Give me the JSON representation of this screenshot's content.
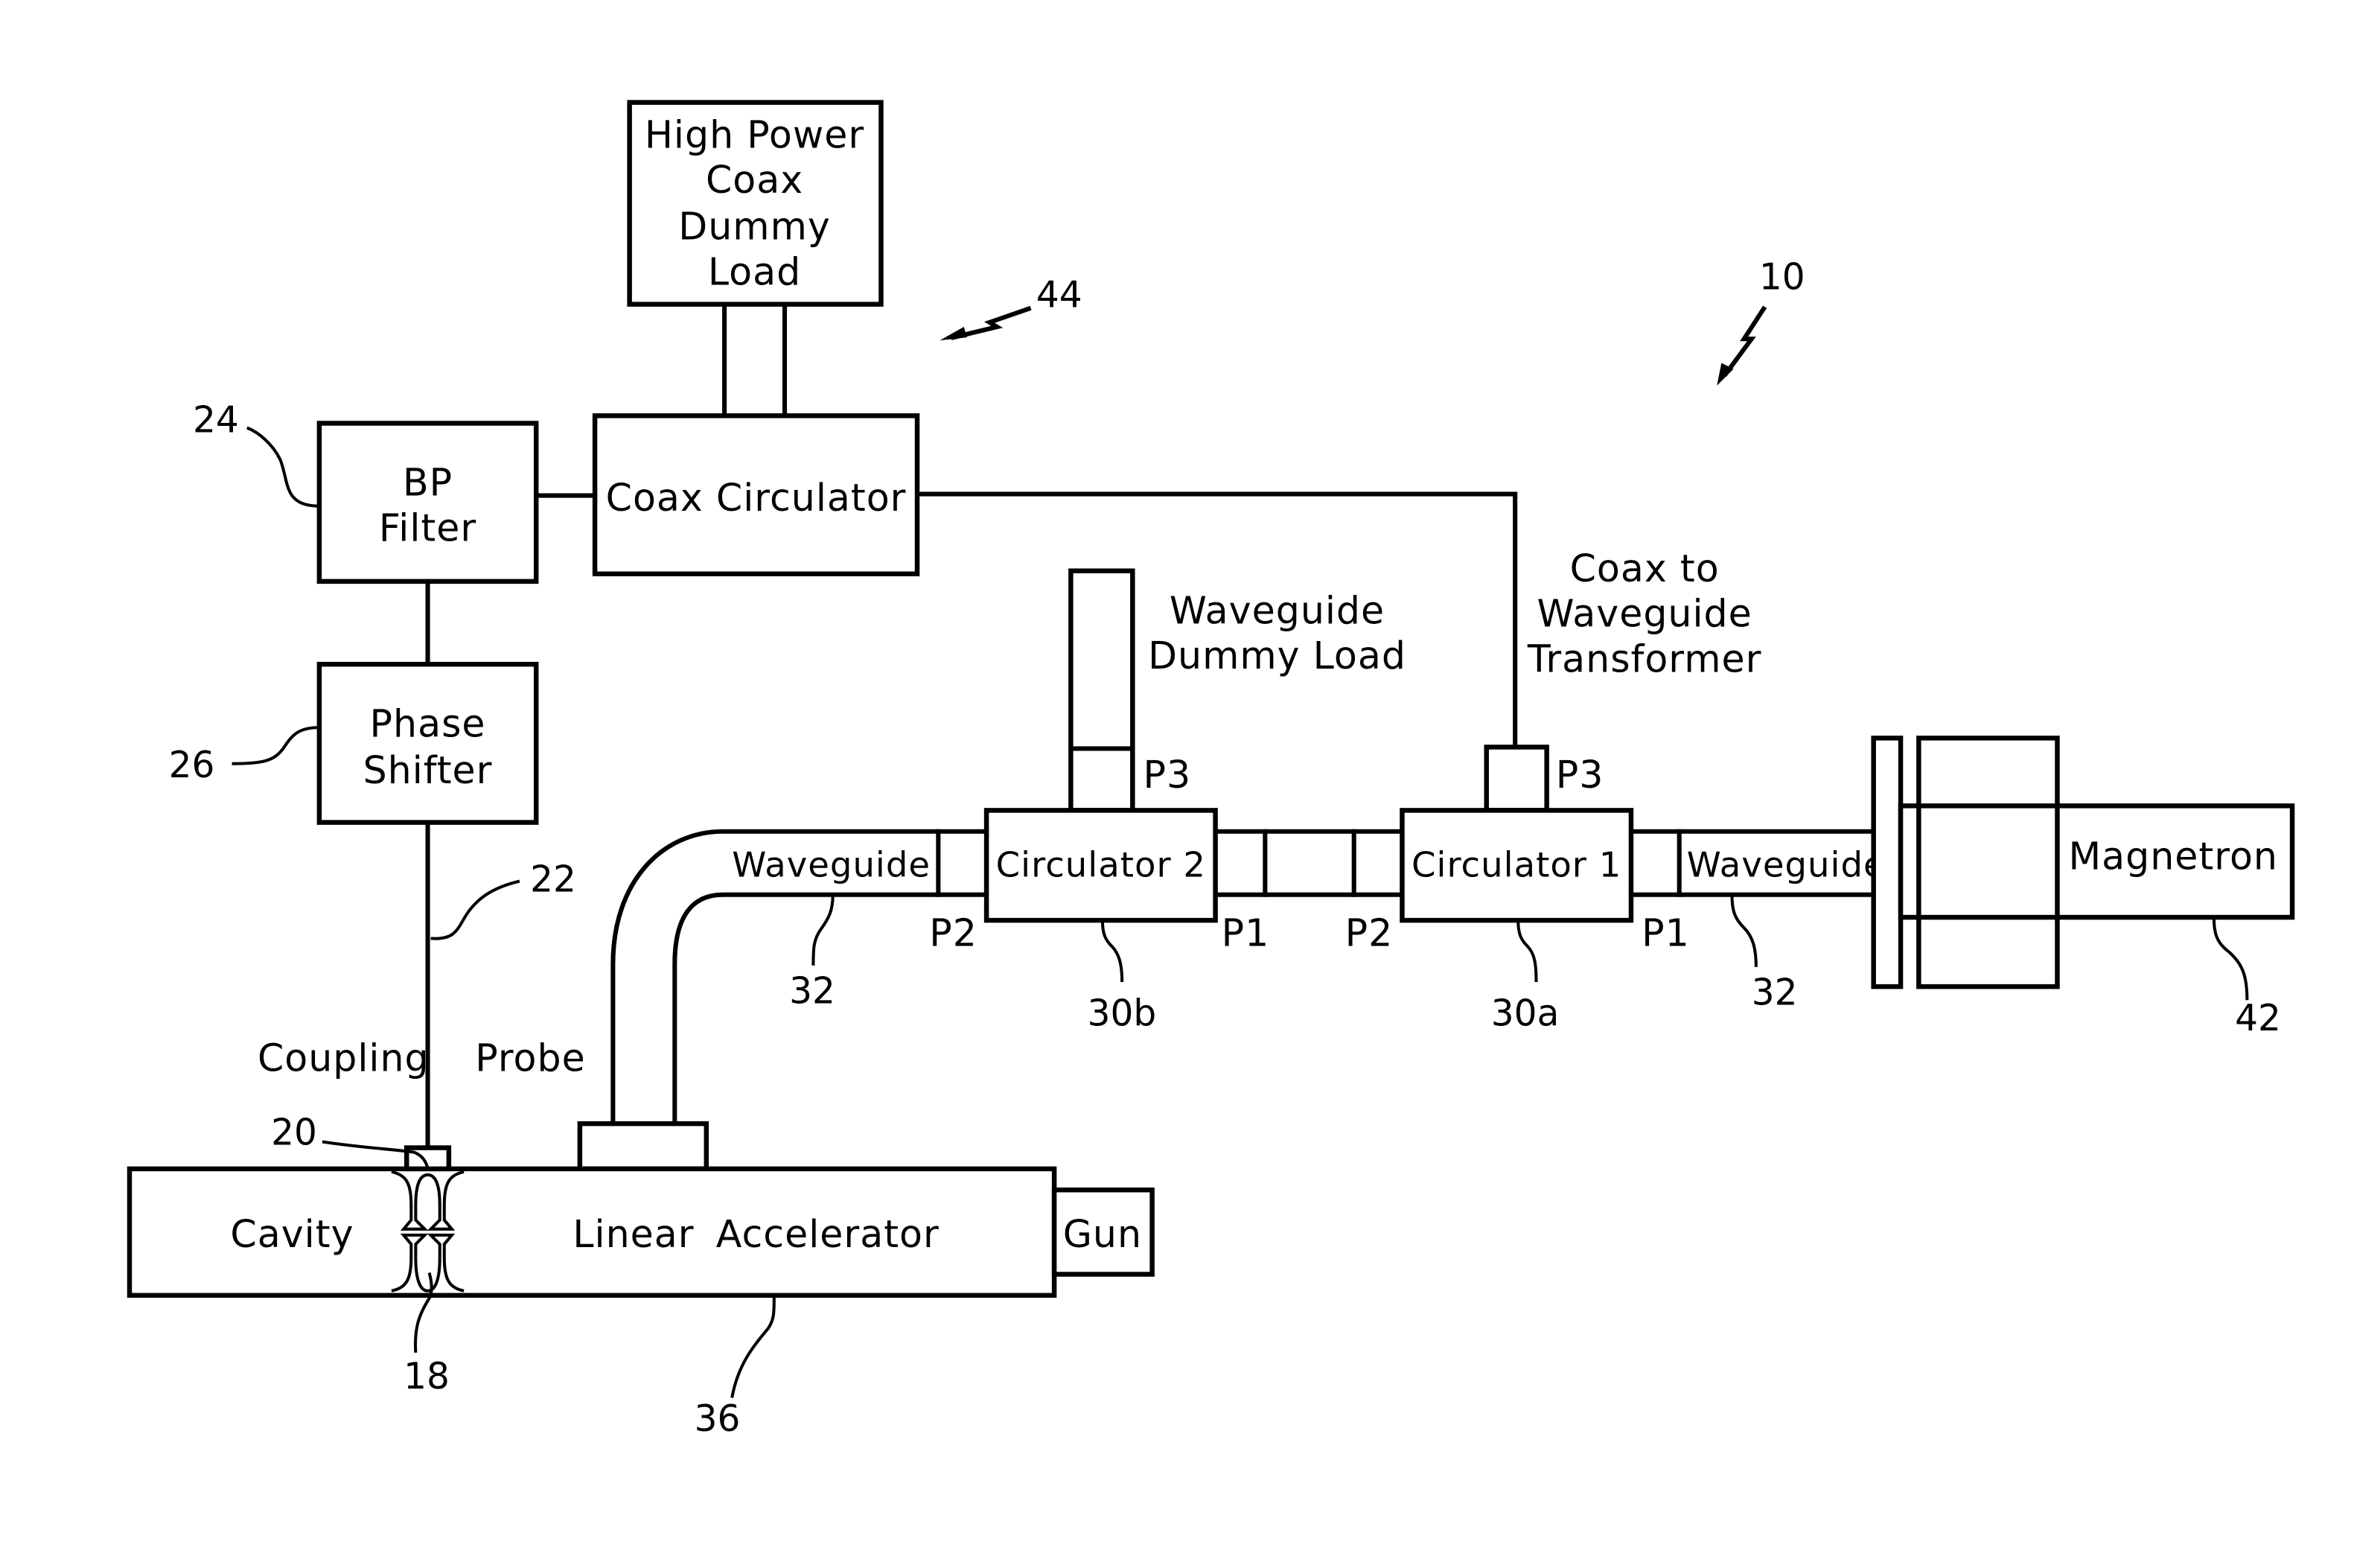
{
  "figure": {
    "system_ref": "10",
    "coax_network_ref": "44"
  },
  "blocks": {
    "dummy_load": {
      "lines": [
        "High Power",
        "Coax",
        "Dummy",
        "Load"
      ]
    },
    "coax_circulator": {
      "label": "Coax Circulator"
    },
    "bp_filter": {
      "lines": [
        "BP",
        "Filter"
      ],
      "ref": "24"
    },
    "phase_shifter": {
      "lines": [
        "Phase",
        "Shifter"
      ],
      "ref": "26"
    },
    "waveguide_dummy_load": {
      "lines": [
        "Waveguide",
        "Dummy Load"
      ]
    },
    "transformer": {
      "lines": [
        "Coax to",
        "Waveguide",
        "Transformer"
      ]
    },
    "circulator_2": {
      "label": "Circulator 2",
      "ref": "30b",
      "ports": {
        "p1": "P1",
        "p2": "P2",
        "p3": "P3"
      }
    },
    "circulator_1": {
      "label": "Circulator 1",
      "ref": "30a",
      "ports": {
        "p1": "P1",
        "p2": "P2",
        "p3": "P3"
      }
    },
    "waveguide_left": {
      "label": "Waveguide",
      "ref": "32"
    },
    "waveguide_right": {
      "label": "Waveguide",
      "ref": "32"
    },
    "magnetron": {
      "label": "Magnetron",
      "ref": "42"
    },
    "coupling_probe": {
      "label": "Coupling Probe",
      "line_ref": "22",
      "probe_ref": "20"
    },
    "cavity": {
      "label": "Cavity",
      "ref": "18"
    },
    "linac": {
      "label": "Linear Accelerator",
      "ref": "36"
    },
    "gun": {
      "label": "Gun"
    }
  }
}
